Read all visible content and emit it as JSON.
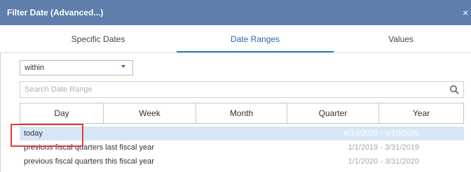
{
  "dialog": {
    "title": "Filter Date (Advanced...)",
    "close_glyph": "×"
  },
  "tabs": [
    {
      "label": "Specific Dates"
    },
    {
      "label": "Date Ranges",
      "active": true
    },
    {
      "label": "Values"
    }
  ],
  "select": {
    "value": "within",
    "icon": "chevron-down-icon"
  },
  "search": {
    "placeholder": "Search Date Range",
    "value": "",
    "icon": "search-icon"
  },
  "periods": [
    {
      "label": "Day"
    },
    {
      "label": "Week"
    },
    {
      "label": "Month"
    },
    {
      "label": "Quarter"
    },
    {
      "label": "Year"
    }
  ],
  "ranges": [
    {
      "label": "today",
      "range": "6/10/2020 - 6/10/2020",
      "selected": true
    },
    {
      "label": "previous fiscal quarters last fiscal year",
      "range": "1/1/2019 - 3/31/2019"
    },
    {
      "label": "previous fiscal quarters this fiscal year",
      "range": "1/1/2020 - 3/31/2020"
    }
  ],
  "colors": {
    "titlebar": "#5f7eac",
    "accent": "#2e7bd1",
    "selected_row": "#d7e6f6",
    "highlight": "#e23b3b"
  }
}
